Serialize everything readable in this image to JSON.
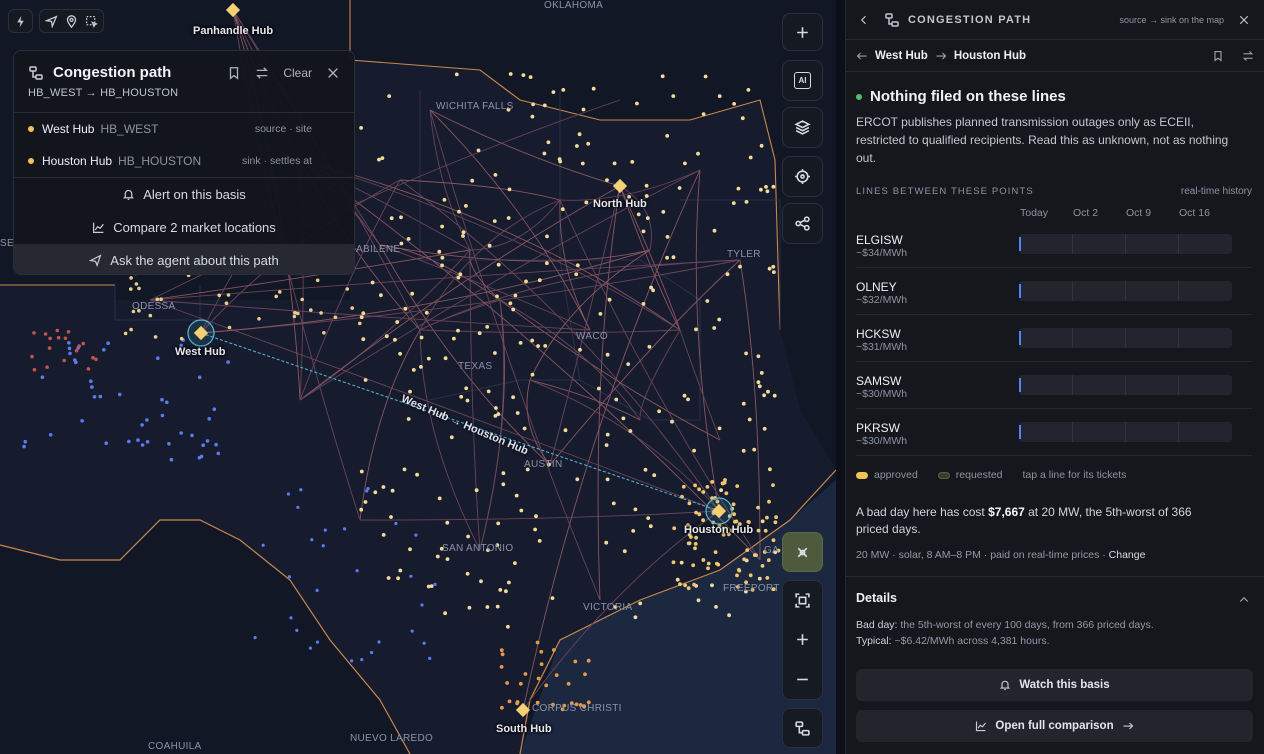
{
  "map": {
    "regions": [
      "OKLAHOMA",
      "WICHITA FALLS",
      "ABILENE",
      "ODESSA",
      "TEXAS",
      "WACO",
      "TYLER",
      "AUSTIN",
      "SAN ANTONIO",
      "VICTORIA",
      "FREEPORT",
      "CORPUS CHRISTI",
      "NUEVO LAREDO",
      "COAHUILA",
      "GA",
      "SE"
    ],
    "hubs": {
      "panhandle": "Panhandle Hub",
      "north": "North Hub",
      "west": "West Hub",
      "houston": "Houston Hub",
      "south": "South Hub"
    },
    "path_label": "West Hub → Houston Hub",
    "colors": {
      "approved": "#f0c453",
      "blue_points": "#5a7cf0",
      "red_points": "#c0554a",
      "orange": "#e89a4a",
      "path": "#52b6d6",
      "roads": "#b45a5a"
    }
  },
  "card": {
    "title": "Congestion path",
    "subtitle": "HB_WEST → HB_HOUSTON",
    "clear": "Clear",
    "hubs": [
      {
        "name": "West Hub",
        "code": "HB_WEST",
        "role": "source · site"
      },
      {
        "name": "Houston Hub",
        "code": "HB_HOUSTON",
        "role": "sink · settles at"
      }
    ],
    "actions": {
      "alert": "Alert on this basis",
      "compare": "Compare 2 market locations",
      "ask": "Ask the agent about this path"
    }
  },
  "controls": {
    "ai": "AI"
  },
  "panel": {
    "title": "CONGESTION PATH",
    "hint": "source → sink on the map",
    "route_from": "West Hub",
    "route_to": "Houston Hub",
    "status_title": "Nothing filed on these lines",
    "status_body": "ERCOT publishes planned transmission outages only as ECEII, restricted to qualified recipients. Read this as unknown, not as nothing out.",
    "lines_heading": "LINES BETWEEN THESE POINTS",
    "lines_mode": "real-time history",
    "dates": [
      "Today",
      "Oct 2",
      "Oct 9",
      "Oct 16"
    ],
    "lines": [
      {
        "name": "ELGISW",
        "price": "~$34/MWh"
      },
      {
        "name": "OLNEY",
        "price": "~$32/MWh"
      },
      {
        "name": "HCKSW",
        "price": "~$31/MWh"
      },
      {
        "name": "SAMSW",
        "price": "~$30/MWh"
      },
      {
        "name": "PKRSW",
        "price": "~$30/MWh"
      }
    ],
    "legend": {
      "approved": "approved",
      "requested": "requested",
      "hint": "tap a line for its tickets"
    },
    "cost_pre": "A bad day here has cost ",
    "cost_value": "$7,667",
    "cost_post": " at 20 MW, the 5th-worst of 366 priced days.",
    "assumptions": "20 MW · solar, 8 AM–8 PM · paid on real-time prices · ",
    "change": "Change",
    "details_title": "Details",
    "bad_day_key": "Bad day:",
    "bad_day_val": " the 5th-worst of every 100 days, from 366 priced days.",
    "typical_key": "Typical:",
    "typical_val": " ~$6.42/MWh across 4,381 hours.",
    "watch": "Watch this basis",
    "open": "Open full comparison"
  }
}
